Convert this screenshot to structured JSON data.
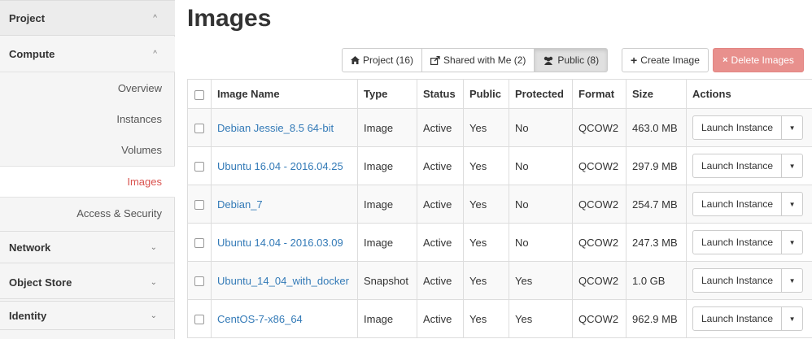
{
  "sidebar": {
    "project": "Project",
    "compute": "Compute",
    "items": [
      {
        "label": "Overview"
      },
      {
        "label": "Instances"
      },
      {
        "label": "Volumes"
      },
      {
        "label": "Images"
      },
      {
        "label": "Access & Security"
      }
    ],
    "network": "Network",
    "object_store": "Object Store",
    "identity": "Identity"
  },
  "page": {
    "title": "Images"
  },
  "filters": {
    "project": "Project (16)",
    "shared": "Shared with Me (2)",
    "public": "Public (8)",
    "active": "Public"
  },
  "actions": {
    "create": "Create Image",
    "delete": "Delete Images"
  },
  "table": {
    "headers": {
      "name": "Image Name",
      "type": "Type",
      "status": "Status",
      "public": "Public",
      "protected": "Protected",
      "format": "Format",
      "size": "Size",
      "actions": "Actions"
    },
    "launch_label": "Launch Instance",
    "rows": [
      {
        "name": "Debian Jessie_8.5 64-bit",
        "type": "Image",
        "status": "Active",
        "public": "Yes",
        "protected": "No",
        "format": "QCOW2",
        "size": "463.0 MB"
      },
      {
        "name": "Ubuntu 16.04 - 2016.04.25",
        "type": "Image",
        "status": "Active",
        "public": "Yes",
        "protected": "No",
        "format": "QCOW2",
        "size": "297.9 MB"
      },
      {
        "name": "Debian_7",
        "type": "Image",
        "status": "Active",
        "public": "Yes",
        "protected": "No",
        "format": "QCOW2",
        "size": "254.7 MB"
      },
      {
        "name": "Ubuntu 14.04 - 2016.03.09",
        "type": "Image",
        "status": "Active",
        "public": "Yes",
        "protected": "No",
        "format": "QCOW2",
        "size": "247.3 MB"
      },
      {
        "name": "Ubuntu_14_04_with_docker",
        "type": "Snapshot",
        "status": "Active",
        "public": "Yes",
        "protected": "Yes",
        "format": "QCOW2",
        "size": "1.0 GB"
      },
      {
        "name": "CentOS-7-x86_64",
        "type": "Image",
        "status": "Active",
        "public": "Yes",
        "protected": "Yes",
        "format": "QCOW2",
        "size": "962.9 MB"
      }
    ]
  },
  "colors": {
    "accent_red": "#d9534f",
    "link_blue": "#337ab7",
    "delete_button": "#e8908d"
  }
}
